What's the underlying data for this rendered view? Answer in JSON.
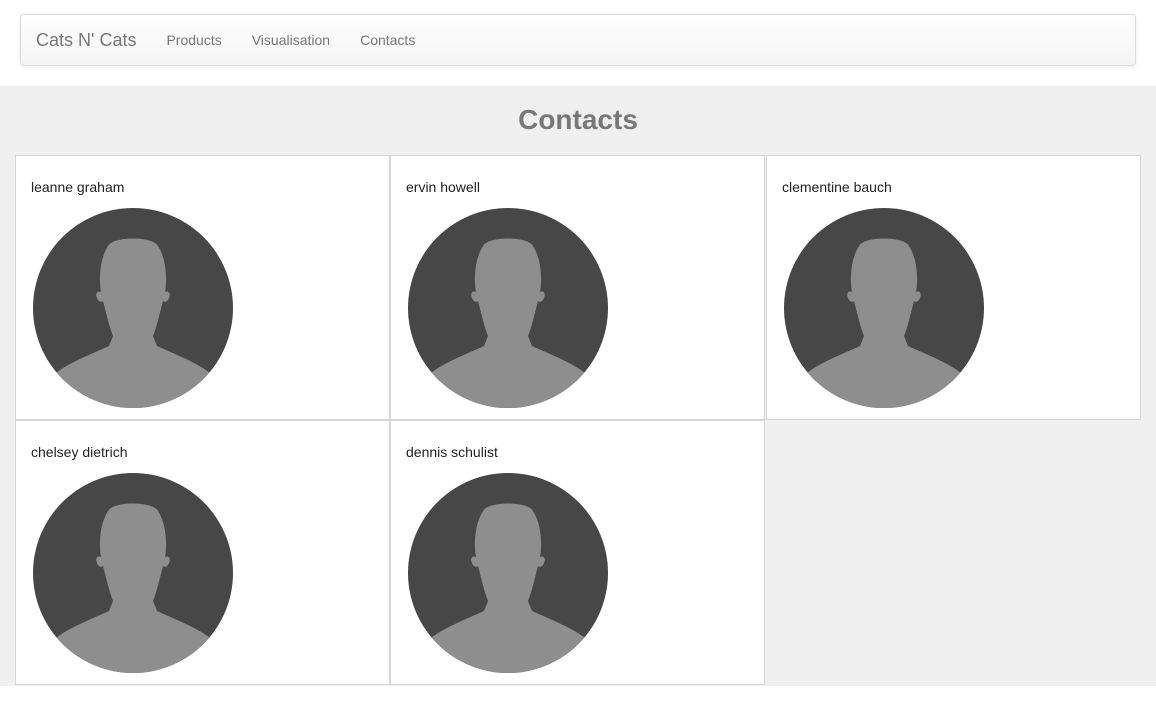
{
  "navbar": {
    "brand": "Cats N' Cats",
    "links": [
      "Products",
      "Visualisation",
      "Contacts"
    ]
  },
  "page": {
    "title": "Contacts"
  },
  "contacts": [
    {
      "name": "leanne graham",
      "avatar_icon": "default-user-avatar-icon"
    },
    {
      "name": "ervin howell",
      "avatar_icon": "default-user-avatar-icon"
    },
    {
      "name": "clementine bauch",
      "avatar_icon": "default-user-avatar-icon"
    },
    {
      "name": "chelsey dietrich",
      "avatar_icon": "default-user-avatar-icon"
    },
    {
      "name": "dennis schulist",
      "avatar_icon": "default-user-avatar-icon"
    }
  ],
  "colors": {
    "avatar_bg": "#474747",
    "avatar_silhouette": "#8e8e8e",
    "page_bg": "#f0f0f0",
    "text_muted": "#777777"
  }
}
